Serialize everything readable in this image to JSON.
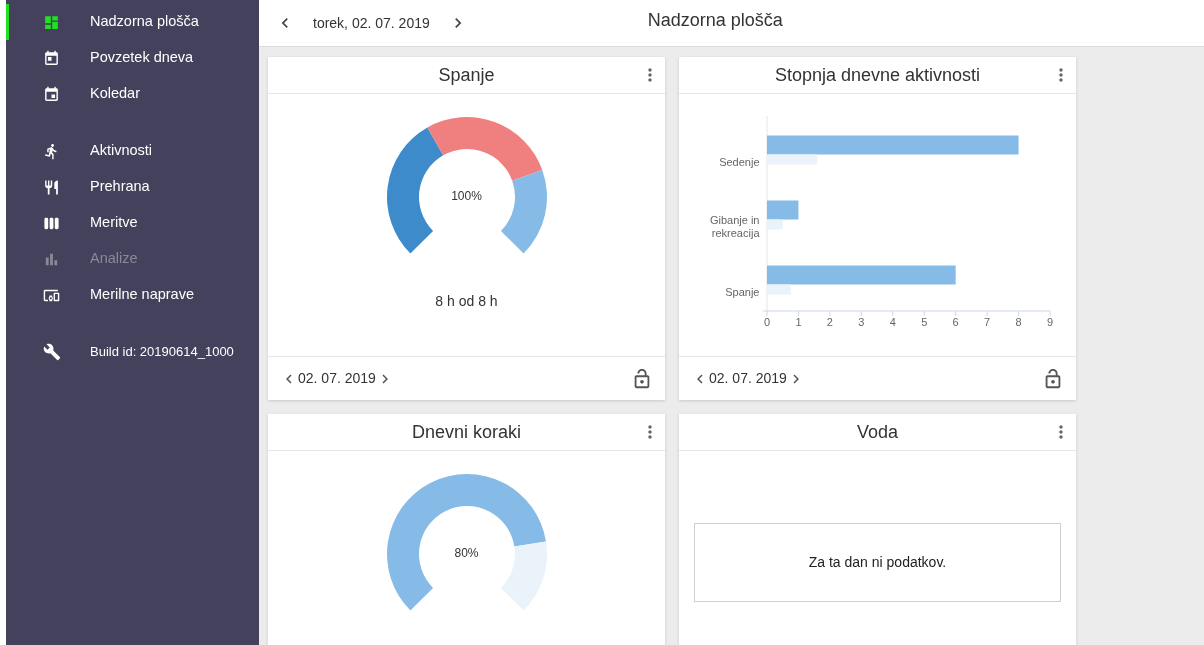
{
  "sidebar": {
    "groups": [
      [
        {
          "label": "Nadzorna plošča",
          "selected": true,
          "disabled": false,
          "kind": "nav"
        },
        {
          "label": "Povzetek dneva",
          "selected": false,
          "disabled": false,
          "kind": "nav"
        },
        {
          "label": "Koledar",
          "selected": false,
          "disabled": false,
          "kind": "nav"
        }
      ],
      [
        {
          "label": "Aktivnosti",
          "selected": false,
          "disabled": false,
          "kind": "nav"
        },
        {
          "label": "Prehrana",
          "selected": false,
          "disabled": false,
          "kind": "nav"
        },
        {
          "label": "Meritve",
          "selected": false,
          "disabled": false,
          "kind": "nav"
        },
        {
          "label": "Analize",
          "selected": false,
          "disabled": true,
          "kind": "nav"
        },
        {
          "label": "Merilne naprave",
          "selected": false,
          "disabled": false,
          "kind": "nav"
        }
      ],
      [
        {
          "label": "Build id: 20190614_1000",
          "kind": "info"
        }
      ]
    ]
  },
  "header": {
    "date": "torek, 02. 07. 2019",
    "title": "Nadzorna plošča"
  },
  "cards": [
    {
      "kind": "gauge",
      "title": "Spanje",
      "value": "100%",
      "caption": "8 h od 8 h",
      "footer_date": "02. 07. 2019"
    },
    {
      "kind": "bars",
      "title": "Stopnja dnevne aktivnosti",
      "footer_date": "02. 07. 2019",
      "chart_data": {
        "type": "bar",
        "orientation": "horizontal",
        "categories": [
          "Sedenje",
          "Gibanje in rekreacija",
          "Spanje"
        ],
        "series": [
          {
            "color": "#85bbe6",
            "values": [
              8,
              1,
              6
            ]
          },
          {
            "color": "#eaf2fa",
            "values": [
              1.6,
              0.5,
              0.75
            ]
          }
        ],
        "xlim": [
          0,
          9
        ],
        "xticks": [
          0,
          1,
          2,
          3,
          4,
          5,
          6,
          7,
          8,
          9
        ]
      }
    },
    {
      "kind": "gauge",
      "title": "Dnevni koraki",
      "value": "80%"
    },
    {
      "kind": "empty",
      "title": "Voda",
      "message": "Za ta dan ni podatkov."
    }
  ]
}
